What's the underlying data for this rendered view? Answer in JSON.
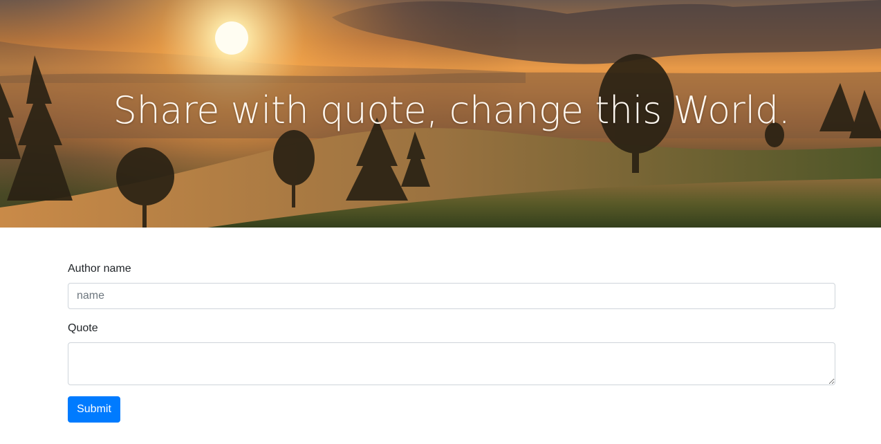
{
  "hero": {
    "title": "Share with quote, change this World."
  },
  "form": {
    "author_label": "Author name",
    "author_placeholder": "name",
    "author_value": "",
    "quote_label": "Quote",
    "quote_value": "",
    "submit_label": "Submit"
  },
  "colors": {
    "button": "#007bff",
    "input_border": "#ced4da",
    "text": "#212529"
  }
}
